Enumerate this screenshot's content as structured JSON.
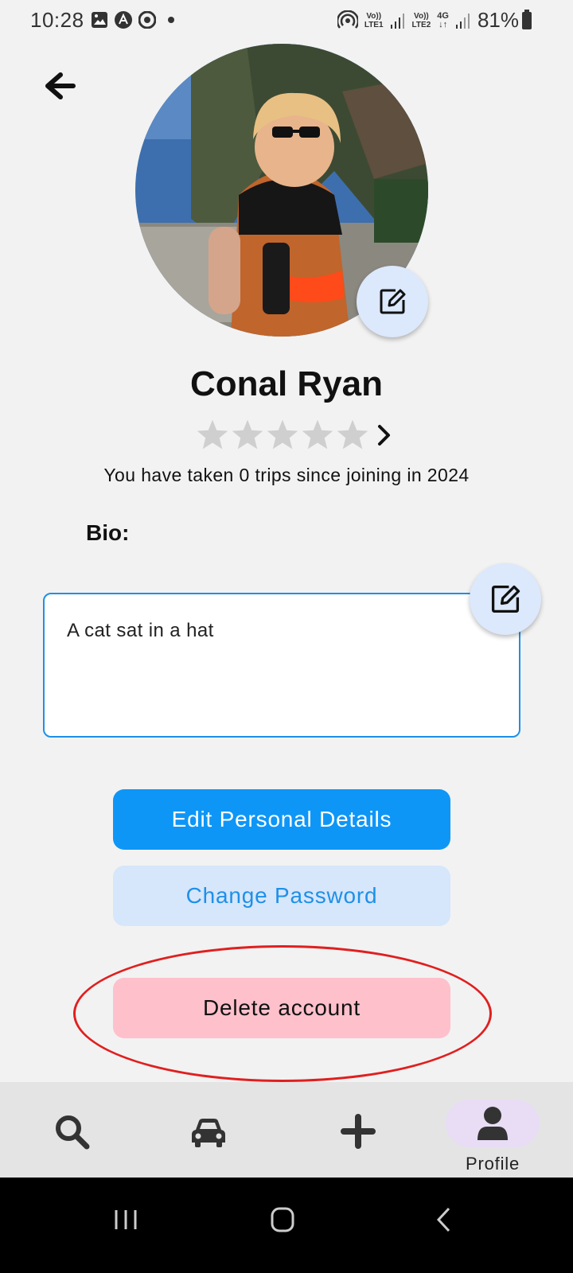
{
  "status_bar": {
    "time": "10:28",
    "battery": "81%",
    "left_icons": [
      "image-icon",
      "app-icon",
      "chrome-icon",
      "dot-icon"
    ],
    "right_icons": [
      "hotspot-icon",
      "volte-lte1-icon",
      "signal-icon",
      "volte-lte2-icon",
      "4g-icon",
      "signal-icon",
      "battery-icon"
    ],
    "lte1": "LTE1",
    "lte2": "LTE2",
    "net": "4G"
  },
  "profile": {
    "name": "Conal Ryan",
    "rating_stars": 0,
    "rating_max": 5,
    "trips_text": "You have taken 0 trips since joining in 2024",
    "bio_label": "Bio:",
    "bio_text": "A cat sat in a hat"
  },
  "buttons": {
    "edit_details": "Edit Personal Details",
    "change_password": "Change Password",
    "delete_account": "Delete account"
  },
  "bottom_nav": {
    "items": [
      {
        "icon": "search-icon",
        "label": ""
      },
      {
        "icon": "car-icon",
        "label": ""
      },
      {
        "icon": "plus-icon",
        "label": ""
      },
      {
        "icon": "person-icon",
        "label": "Profile",
        "active": true
      }
    ]
  },
  "colors": {
    "primary": "#0e96f7",
    "secondary_bg": "#d6e6fb",
    "danger_bg": "#fec0cb",
    "annotation": "#e01f1f",
    "active_pill": "#e8ddf5"
  }
}
